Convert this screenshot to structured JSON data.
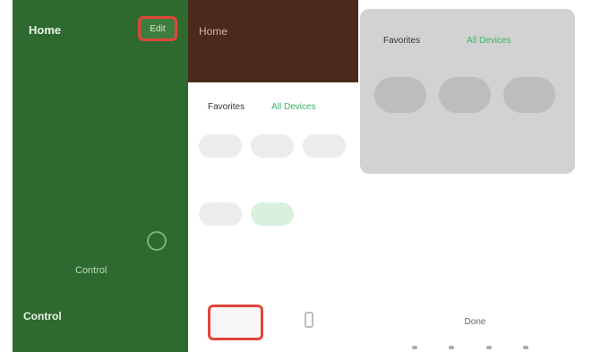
{
  "colors": {
    "green_panel": "#2e6a2f",
    "highlight_red": "#e2453a",
    "brown_bar": "#4a2a1a",
    "accent_green": "#3db16a",
    "grey_sheet": "#d2d2d2"
  },
  "panel_a": {
    "title": "Home",
    "header_button": "Edit",
    "subtitle": "",
    "left_vertical_label": "",
    "right_vertical_label": "",
    "center_label": "Control",
    "footer_left": "Control",
    "footer_right": ""
  },
  "panel_b": {
    "title": "Home",
    "subtitle": "",
    "tabs": [
      "Favorites",
      "All Devices"
    ],
    "row1": [
      "",
      "",
      ""
    ],
    "row1_caption": "",
    "row2": [
      "",
      ""
    ],
    "row2_caption": "",
    "footer_button": ""
  },
  "panel_c": {
    "tabs": [
      "Favorites",
      "All Devices"
    ],
    "pills": [
      "",
      "",
      ""
    ],
    "caption": "",
    "half_pills": [
      "",
      ""
    ],
    "menu": [
      "",
      "",
      "",
      ""
    ],
    "cancel": "Done"
  }
}
